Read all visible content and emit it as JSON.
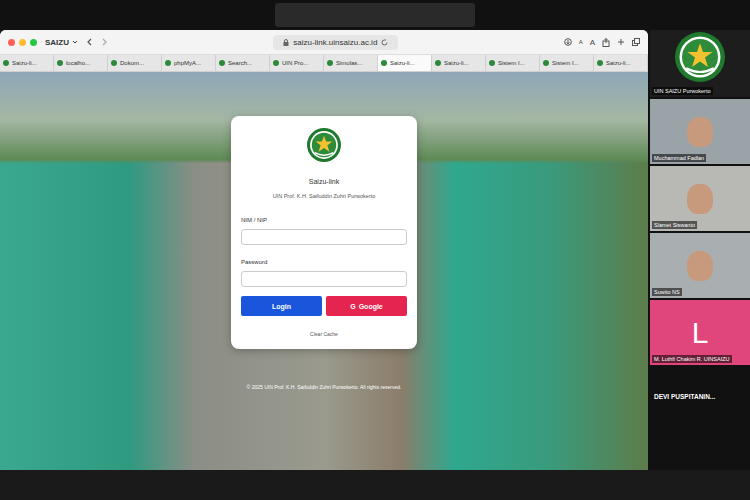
{
  "window": {
    "title": "Saizu-link"
  },
  "browser": {
    "profile": "SAIZU",
    "address": "saizu-link.uinsaizu.ac.id",
    "text_size": [
      "A",
      "A"
    ]
  },
  "tabs": [
    {
      "label": "Saizu-li...",
      "selected": false
    },
    {
      "label": "localho...",
      "selected": false
    },
    {
      "label": "Dokum...",
      "selected": false
    },
    {
      "label": "phpMyA...",
      "selected": false
    },
    {
      "label": "Search...",
      "selected": false
    },
    {
      "label": "UIN Pro...",
      "selected": false
    },
    {
      "label": "Simulas...",
      "selected": false
    },
    {
      "label": "Saizu-li...",
      "selected": true
    },
    {
      "label": "Saizu-li...",
      "selected": false
    },
    {
      "label": "Sistem I...",
      "selected": false
    },
    {
      "label": "Sistem I...",
      "selected": false
    },
    {
      "label": "Saizu-li...",
      "selected": false
    }
  ],
  "login": {
    "title": "Saizu-link",
    "subtitle": "UIN Prof. K.H. Saifuddin Zuhri Purwokerto",
    "id_label": "NIM / NIP",
    "password_label": "Password",
    "login_button": "Login",
    "google_button": "Google",
    "google_icon": "G",
    "clear_cache": "Clear Cache",
    "footer": "© 2025 UIN Prof. K.H. Saifuddin Zuhri Purwokerto. All rights reserved."
  },
  "participants": [
    {
      "name": "UIN SAIZU Purwokerto",
      "kind": "logo"
    },
    {
      "name": "Muchammad Fadlan",
      "kind": "video"
    },
    {
      "name": "Slamet Siswanto",
      "kind": "video"
    },
    {
      "name": "Suwito NS",
      "kind": "video"
    },
    {
      "name": "M. Luthfi Chakim R. UINSAIZU",
      "kind": "avatar",
      "avatar": "L",
      "color": "#e0457b"
    }
  ],
  "more_participant": "DEVI PUSPITANIN..."
}
